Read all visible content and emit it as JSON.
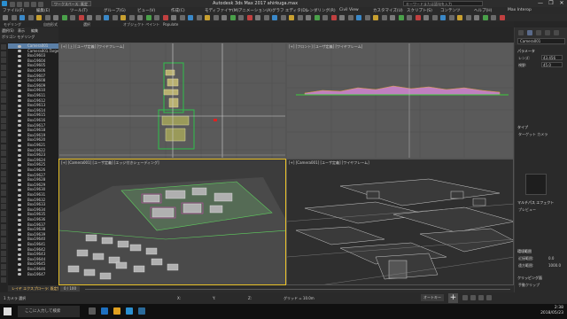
{
  "window": {
    "title": "Autodesk 3ds Max 2017    ahirkuga.max",
    "workspace": "ワークスペース: 既定",
    "search": "キーワードまたは語句を入力",
    "min": "—",
    "max": "❐",
    "close": "✕"
  },
  "menu": [
    "ファイル(F)",
    "編集(E)",
    "ツール(T)",
    "グループ(G)",
    "ビュー(V)",
    "作成(C)",
    "モディファイヤ(M)",
    "アニメーション(A)",
    "グラフ エディタ(D)",
    "レンダリング(R)",
    "Civil View",
    "カスタマイズ(U)",
    "スクリプト(S)",
    "コンテンツ",
    "ヘルプ(H)",
    "Max Interop"
  ],
  "ribbon": [
    "モデリング",
    "自由形式",
    "選択",
    "オブジェクト ペイント",
    "Populate"
  ],
  "scene_tabs": {
    "a": "選択(S)",
    "b": "表示",
    "c": "編集",
    "d": "ポリゴン モデリング"
  },
  "explorer": {
    "rows": [
      "Camera001",
      "Camera001.Target",
      "Box19603",
      "Box19604",
      "Box19605",
      "Box19606",
      "Box19607",
      "Box19608",
      "Box19609",
      "Box19610",
      "Box19611",
      "Box19612",
      "Box19613",
      "Box19614",
      "Box19615",
      "Box19616",
      "Box19617",
      "Box19618",
      "Box19619",
      "Box19620",
      "Box19621",
      "Box19622",
      "Box19623",
      "Box19624",
      "Box19625",
      "Box19626",
      "Box19627",
      "Box19628",
      "Box19629",
      "Box19630",
      "Box19631",
      "Box19632",
      "Box19633",
      "Box19634",
      "Box19635",
      "Box19636",
      "Box19637",
      "Box19638",
      "Box19639",
      "Box19640",
      "Box19641",
      "Box19642",
      "Box19643",
      "Box19644",
      "Box19645",
      "Box19646",
      "Box19647"
    ],
    "selected_index": 0,
    "layer": "レイヤ エクスプローラ: 既定値"
  },
  "viewports": {
    "top": "[+] [上] [ユーザ定義] [ワイヤフレーム]",
    "front": "[+] [フロント] [ユーザ定義] [ワイヤフレーム]",
    "camera1": "[+] [Camera001] [ユーザ定義] [エッジ付きシェーディング]",
    "camera2": "[+] [Camera001] [ユーザ定義] [ワイヤフレーム]"
  },
  "cmd": {
    "name": "Camera001",
    "sec1": "パラメータ",
    "p1": "レンズ:",
    "p1v": "43.456",
    "p2": "視野:",
    "p2v": "45.0",
    "sec2": "タイプ",
    "r1": "ターゲット カメラ",
    "sec3": "マルチパス エフェクト",
    "r2": "プレビュー",
    "sec4": "環境範囲",
    "r3": "近接範囲:",
    "r3v": "0.0",
    "r4": "遠方範囲:",
    "r4v": "1000.0",
    "sec5": "クリッピング面",
    "r5": "手動クリップ"
  },
  "timeline": {
    "frame": "0 / 100"
  },
  "status": {
    "sel": "1 カメラ 選択",
    "x": "X:",
    "y": "Y:",
    "z": "Z:",
    "grid": "グリッド = 10.0m",
    "key": "オートキー",
    "addkey": "+"
  },
  "taskbar": {
    "search": "ここに入力して検索",
    "time": "2:38",
    "date": "2018/05/23"
  },
  "colors": {
    "bg": "#262626",
    "active_border": "#e8c028",
    "select": "#5b7fa6"
  }
}
